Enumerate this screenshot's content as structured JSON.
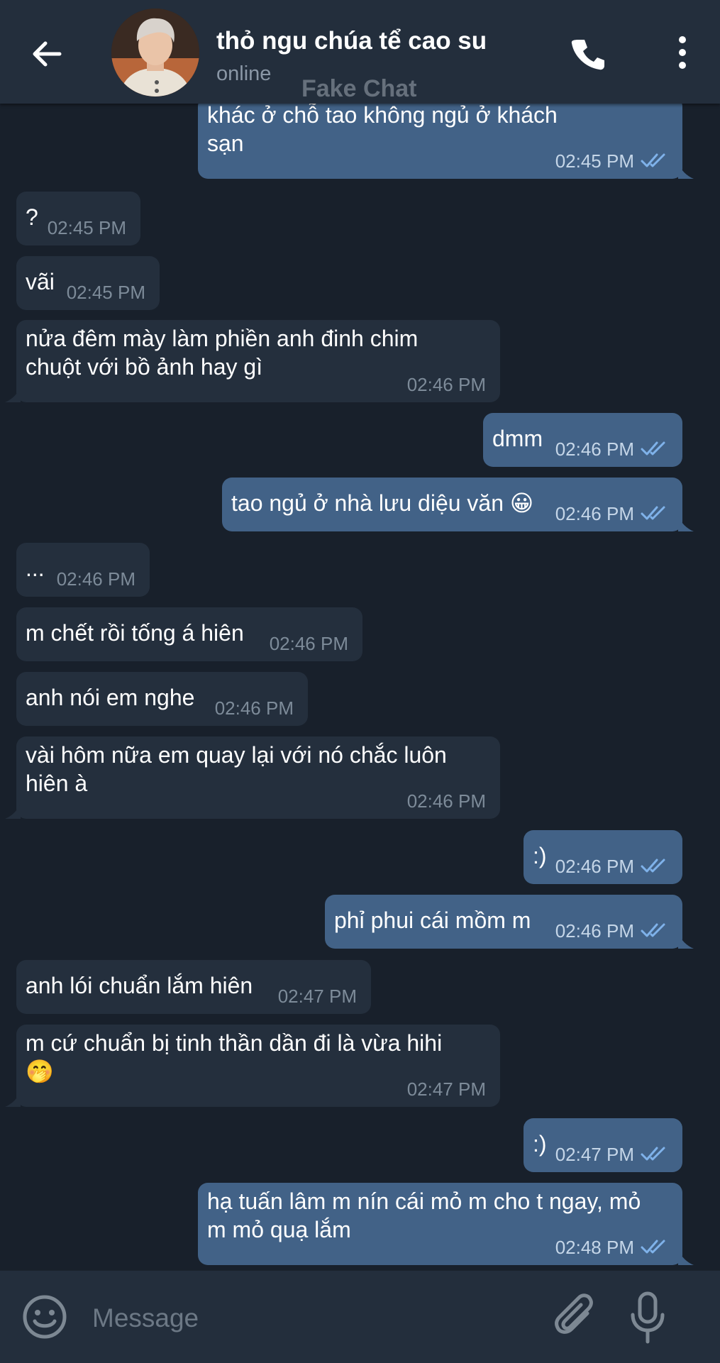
{
  "header": {
    "title": "thỏ ngu chúa tể cao su",
    "status": "online",
    "watermark": "Fake Chat"
  },
  "colors": {
    "background": "#18202b",
    "header": "#232e3c",
    "incoming_bubble": "#242f3d",
    "outgoing_bubble": "#426287",
    "ticks": "#7fb2ea"
  },
  "messages": [
    {
      "dir": "out",
      "text_lines": [
        "khác ở chỗ tao không ngủ ở khách",
        "sạn"
      ],
      "time": "02:45 PM"
    },
    {
      "dir": "in",
      "text_lines": [
        "?"
      ],
      "time": "02:45 PM"
    },
    {
      "dir": "in",
      "text_lines": [
        "vãi"
      ],
      "time": "02:45 PM"
    },
    {
      "dir": "in",
      "text_lines": [
        "nửa đêm mày làm phiền anh đinh chim",
        "chuột với bồ ảnh hay gì"
      ],
      "time": "02:46 PM"
    },
    {
      "dir": "out",
      "text_lines": [
        "dmm"
      ],
      "time": "02:46 PM"
    },
    {
      "dir": "out",
      "text_lines": [
        "tao ngủ ở nhà lưu diệu văn 😀"
      ],
      "time": "02:46 PM"
    },
    {
      "dir": "in",
      "text_lines": [
        "..."
      ],
      "time": "02:46 PM"
    },
    {
      "dir": "in",
      "text_lines": [
        "m chết rồi tống á hiên"
      ],
      "time": "02:46 PM"
    },
    {
      "dir": "in",
      "text_lines": [
        "anh nói em nghe"
      ],
      "time": "02:46 PM"
    },
    {
      "dir": "in",
      "text_lines": [
        "vài hôm nữa em quay lại với nó chắc luôn",
        "hiên à"
      ],
      "time": "02:46 PM"
    },
    {
      "dir": "out",
      "text_lines": [
        ":)"
      ],
      "time": "02:46 PM"
    },
    {
      "dir": "out",
      "text_lines": [
        "phỉ phui cái mồm m"
      ],
      "time": "02:46 PM"
    },
    {
      "dir": "in",
      "text_lines": [
        "anh lói chuẩn lắm hiên"
      ],
      "time": "02:47 PM"
    },
    {
      "dir": "in",
      "text_lines": [
        "m cứ chuẩn bị tinh thần dần đi là vừa hihi",
        "🤭"
      ],
      "time": "02:47 PM"
    },
    {
      "dir": "out",
      "text_lines": [
        ":)"
      ],
      "time": "02:47 PM"
    },
    {
      "dir": "out",
      "text_lines": [
        "hạ tuấn lâm m nín cái mỏ m cho t ngay, mỏ",
        "m mỏ quạ lắm"
      ],
      "time": "02:48 PM"
    }
  ],
  "composer": {
    "placeholder": "Message",
    "icons": [
      "emoji-icon",
      "paperclip-icon",
      "microphone-icon"
    ]
  },
  "header_icons": [
    "back-arrow-icon",
    "phone-icon",
    "more-vertical-icon"
  ]
}
